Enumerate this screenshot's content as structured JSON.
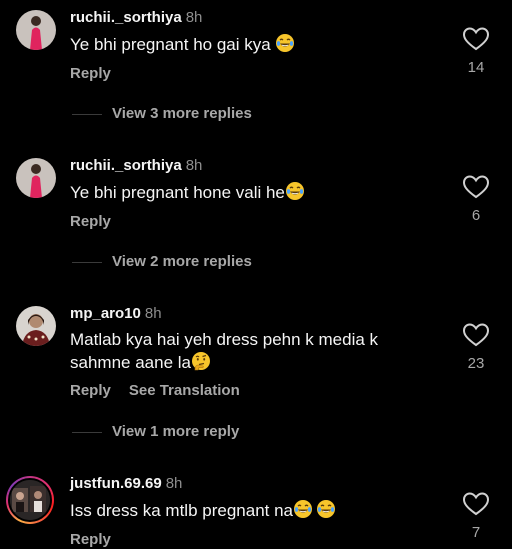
{
  "comments": [
    {
      "username": "ruchii._sorthiya",
      "time": "8h",
      "text": "Ye bhi pregnant ho gai kya",
      "emojis": [
        "laughing-crying-emoji"
      ],
      "reply_label": "Reply",
      "like_count": "14",
      "more_replies": "View 3 more replies"
    },
    {
      "username": "ruchii._sorthiya",
      "time": "8h",
      "text": "Ye bhi pregnant hone vali he",
      "emojis": [
        "laughing-crying-emoji"
      ],
      "reply_label": "Reply",
      "like_count": "6",
      "more_replies": "View 2 more replies"
    },
    {
      "username": "mp_aro10",
      "time": "8h",
      "text_line1": "Matlab kya hai yeh dress pehn k media k",
      "text_line2": "sahmne aane la",
      "emojis": [
        "thinking-face-emoji"
      ],
      "reply_label": "Reply",
      "translation_label": "See Translation",
      "like_count": "23",
      "more_replies": "View 1 more reply"
    },
    {
      "username": "justfun.69.69",
      "time": "8h",
      "text": "Iss dress ka mtlb pregnant na",
      "emojis": [
        "laughing-crying-emoji",
        "laughing-crying-emoji"
      ],
      "reply_label": "Reply",
      "like_count": "7"
    }
  ],
  "icons": {
    "like": "heart-outline-icon"
  },
  "colors": {
    "background": "#000000",
    "primary_text": "#f5f5f5",
    "secondary_text": "#a8a8a8",
    "timestamp": "#8e8e8e"
  }
}
